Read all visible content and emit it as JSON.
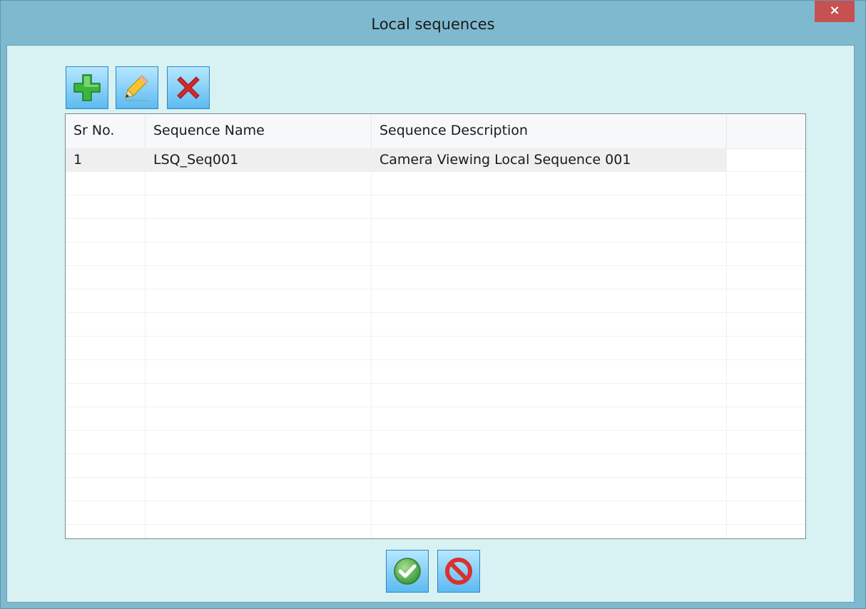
{
  "window": {
    "title": "Local sequences",
    "close_label": "×"
  },
  "toolbar": {
    "buttons": [
      {
        "name": "add",
        "icon": "plus-icon",
        "color": "#3cb53c"
      },
      {
        "name": "edit",
        "icon": "pencil-icon",
        "color": "#f5c431"
      },
      {
        "name": "delete",
        "icon": "x-icon",
        "color": "#d42a2a"
      }
    ]
  },
  "table": {
    "columns": [
      "Sr No.",
      "Sequence Name",
      "Sequence Description",
      ""
    ],
    "rows": [
      {
        "sr_no": "1",
        "name": "LSQ_Seq001",
        "description": "Camera Viewing Local Sequence 001"
      }
    ],
    "empty_row_count": 15
  },
  "footer": {
    "buttons": [
      {
        "name": "ok",
        "icon": "check-circle-icon",
        "color": "#4caf50"
      },
      {
        "name": "cancel",
        "icon": "no-entry-icon",
        "color": "#d93030"
      }
    ]
  },
  "colors": {
    "titlebar": "#7fb9cf",
    "client": "#d8f2f4",
    "close": "#c75050"
  }
}
